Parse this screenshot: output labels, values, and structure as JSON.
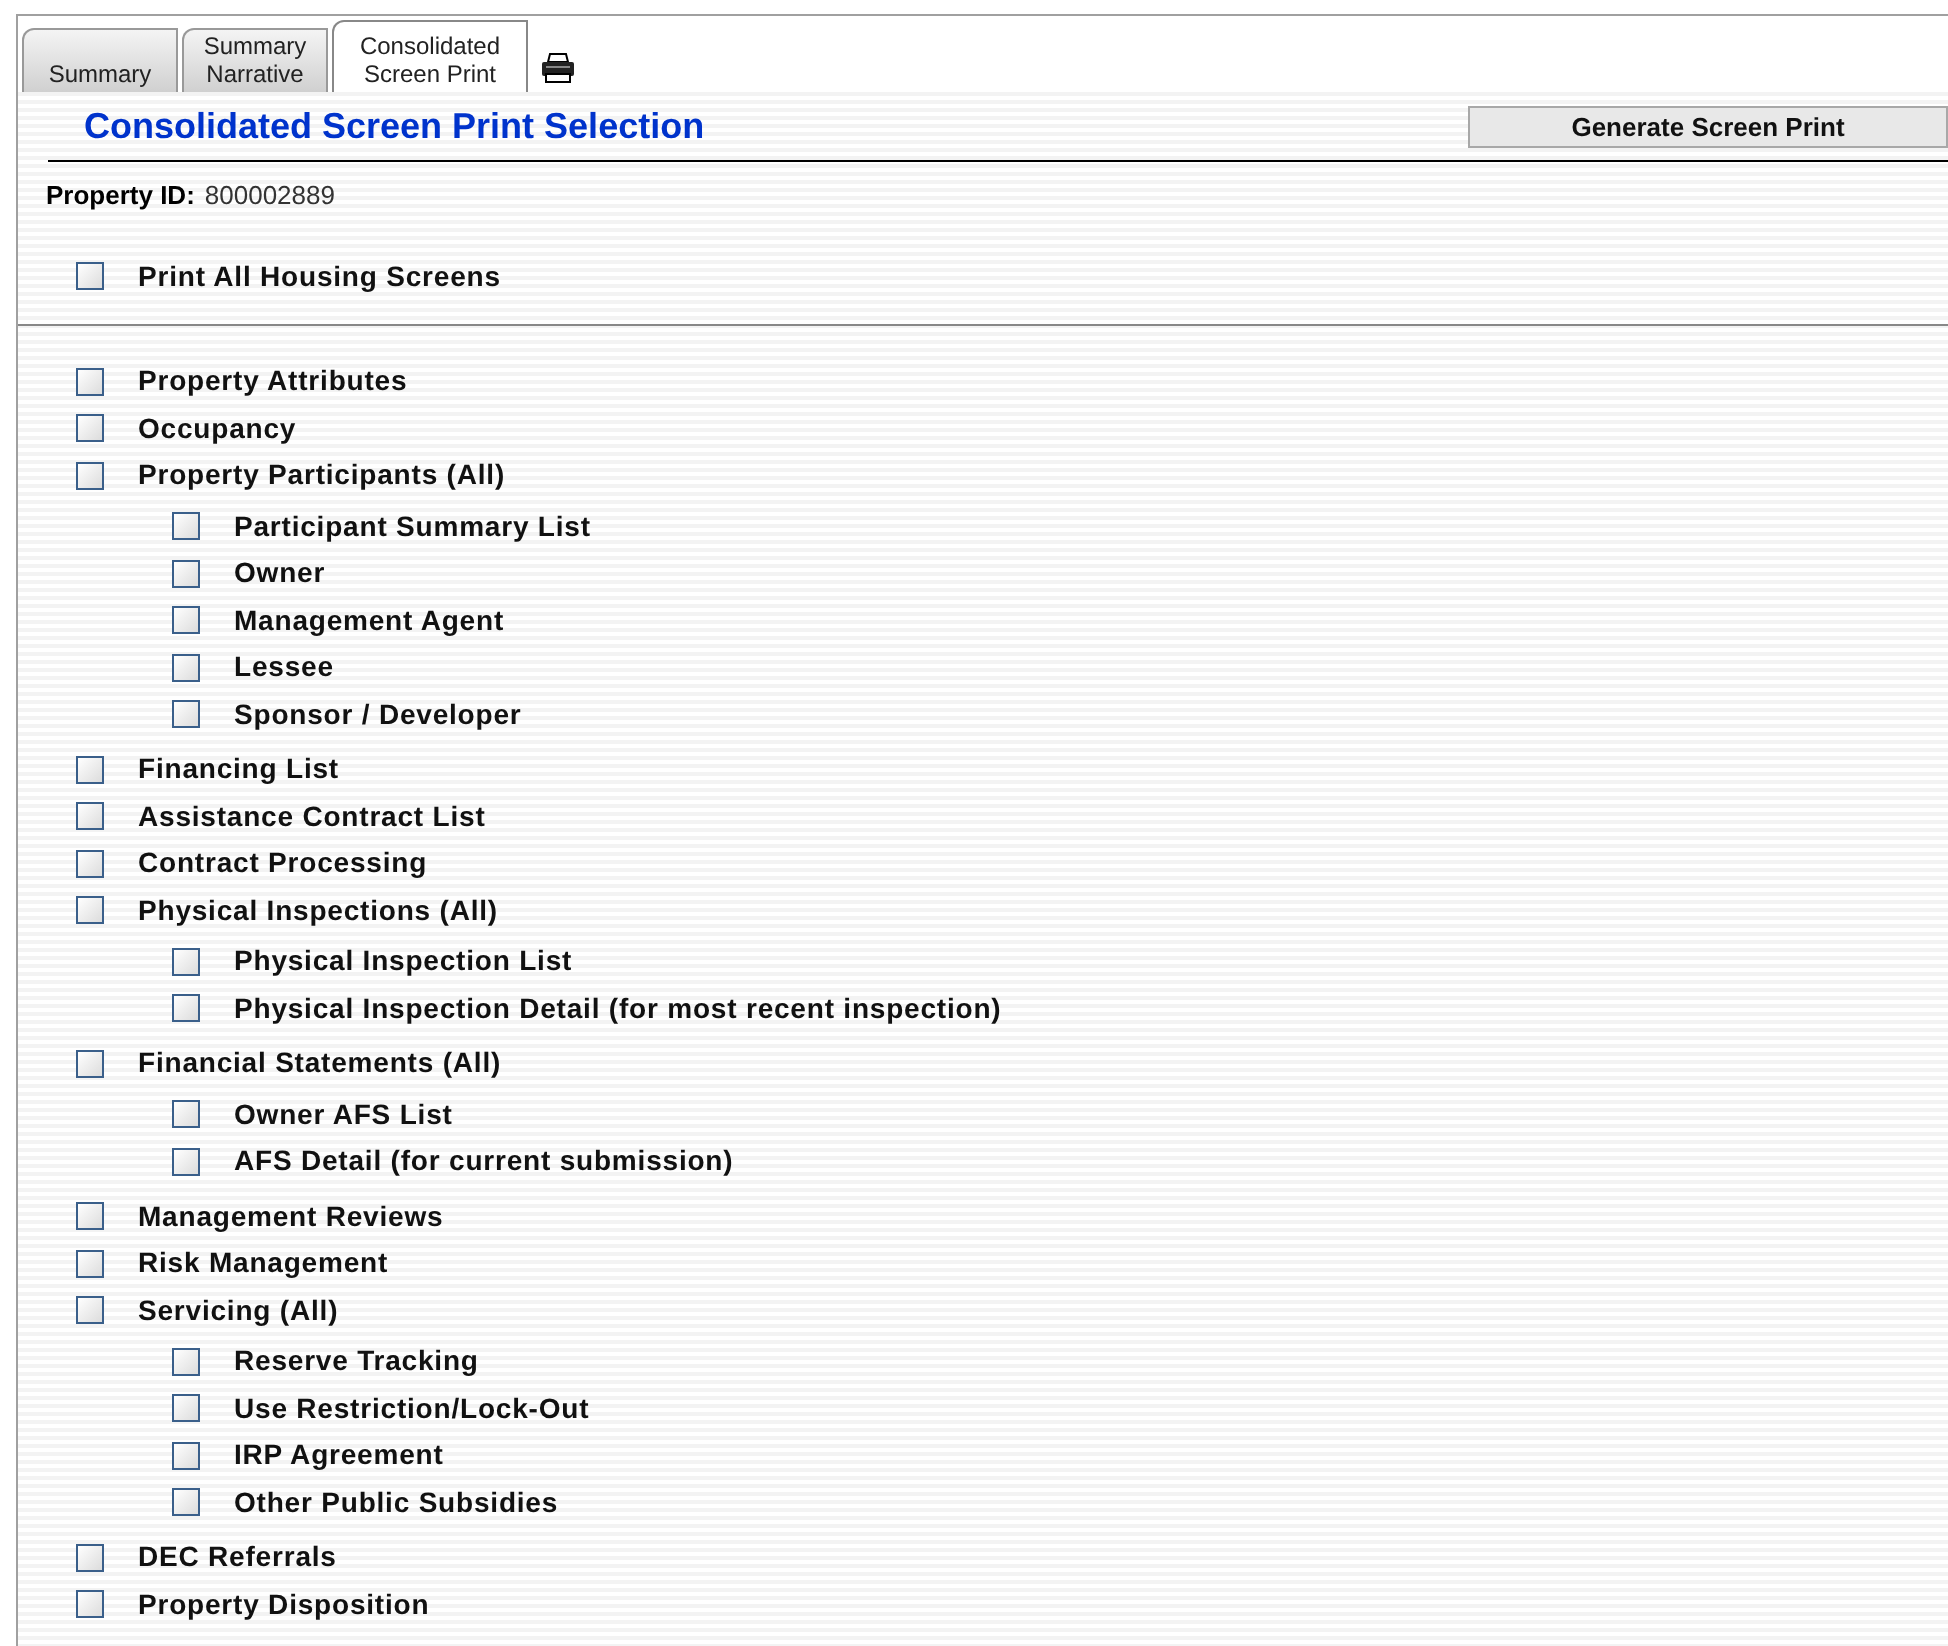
{
  "tabs": [
    {
      "label": "Summary",
      "selected": false
    },
    {
      "label": "Summary Narrative",
      "selected": false
    },
    {
      "label": "Consolidated Screen Print",
      "selected": true
    }
  ],
  "title": "Consolidated Screen Print Selection",
  "generate_button": "Generate Screen Print",
  "property_id": {
    "label": "Property ID:",
    "value": "800002889"
  },
  "print_all": {
    "label": "Print All Housing Screens",
    "checked": false
  },
  "items": [
    {
      "label": "Property Attributes",
      "checked": false
    },
    {
      "label": "Occupancy",
      "checked": false
    },
    {
      "label": "Property Participants (All)",
      "checked": false,
      "children": [
        {
          "label": "Participant Summary List",
          "checked": false
        },
        {
          "label": "Owner",
          "checked": false
        },
        {
          "label": "Management Agent",
          "checked": false
        },
        {
          "label": "Lessee",
          "checked": false
        },
        {
          "label": "Sponsor / Developer",
          "checked": false
        }
      ]
    },
    {
      "label": "Financing List",
      "checked": false
    },
    {
      "label": "Assistance Contract List",
      "checked": false
    },
    {
      "label": "Contract Processing",
      "checked": false
    },
    {
      "label": "Physical Inspections (All)",
      "checked": false,
      "children": [
        {
          "label": "Physical Inspection List",
          "checked": false
        },
        {
          "label": "Physical Inspection Detail (for most recent inspection)",
          "checked": false
        }
      ]
    },
    {
      "label": "Financial Statements (All)",
      "checked": false,
      "children": [
        {
          "label": "Owner AFS List",
          "checked": false
        },
        {
          "label": "AFS Detail (for current submission)",
          "checked": false
        }
      ]
    },
    {
      "label": "Management Reviews",
      "checked": false
    },
    {
      "label": "Risk Management",
      "checked": false
    },
    {
      "label": "Servicing (All)",
      "checked": false,
      "children": [
        {
          "label": "Reserve Tracking",
          "checked": false
        },
        {
          "label": "Use Restriction/Lock-Out",
          "checked": false
        },
        {
          "label": "IRP Agreement",
          "checked": false
        },
        {
          "label": "Other Public Subsidies",
          "checked": false
        }
      ]
    },
    {
      "label": "DEC Referrals",
      "checked": false
    },
    {
      "label": "Property Disposition",
      "checked": false
    }
  ]
}
